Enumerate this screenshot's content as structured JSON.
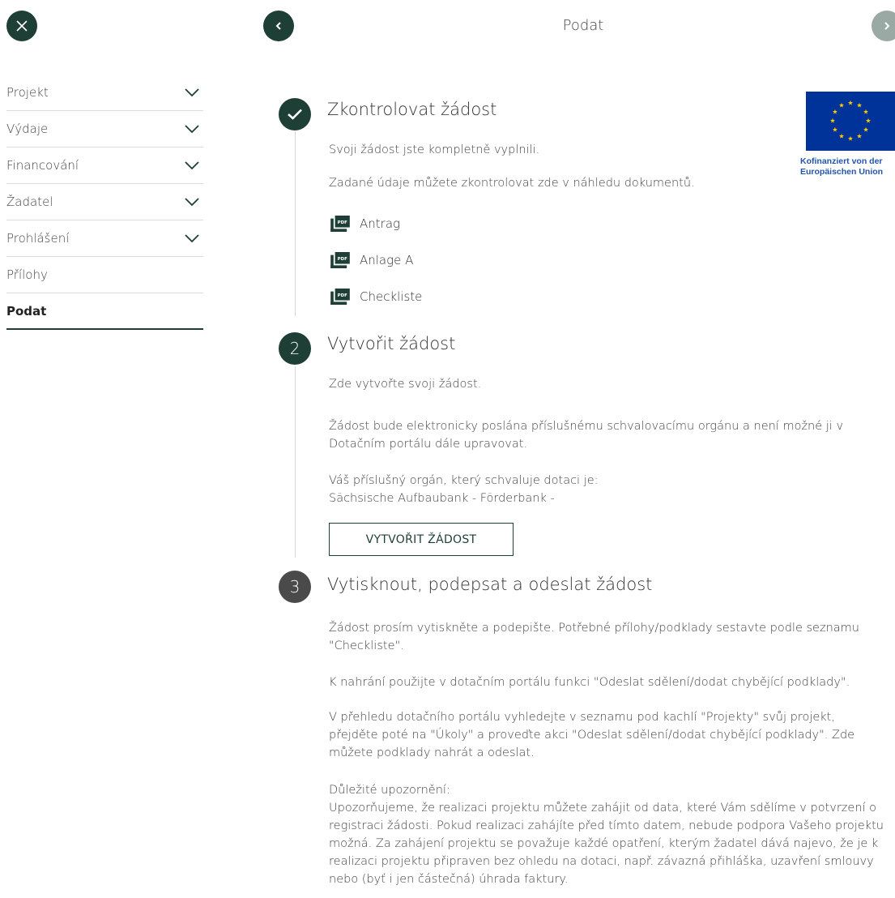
{
  "header": {
    "title": "Podat"
  },
  "sidebar": {
    "items": [
      {
        "label": "Projekt"
      },
      {
        "label": "Výdaje"
      },
      {
        "label": "Financování"
      },
      {
        "label": "Žadatel"
      },
      {
        "label": "Prohlášení"
      },
      {
        "label": "Přílohy"
      },
      {
        "label": "Podat"
      }
    ]
  },
  "step1": {
    "title": "Zkontrolovat žádost",
    "text1": "Svoji žádost jste kompletně vyplnili.",
    "text2": "Zadané údaje můžete zkontrolovat zde v náhledu dokumentů.",
    "documents": [
      {
        "label": "Antrag"
      },
      {
        "label": "Anlage A"
      },
      {
        "label": "Checkliste"
      }
    ]
  },
  "step2": {
    "number": "2",
    "title": "Vytvořit žádost",
    "text1": "Zde vytvořte svoji žádost.",
    "text2": "Žádost bude elektronicky poslána příslušnému schvalovacímu orgánu a není možné ji v Dotačním portálu dále upravovat.",
    "text3a": "Váš příslušný orgán, který schvaluje dotaci je:",
    "text3b": "Sächsische Aufbaubank - Förderbank -",
    "button_label": "VYTVOŘIT ŽÁDOST"
  },
  "step3": {
    "number": "3",
    "title": "Vytisknout, podepsat a odeslat žádost",
    "text1": "Žádost prosím vytiskněte a podepište. Potřebné přílohy/podklady sestavte podle seznamu \"Checkliste\".",
    "text2": "K nahrání použijte v dotačním portálu funkci \"Odeslat sdělení/dodat chybějící podklady\".",
    "text3": "V přehledu dotačního portálu vyhledejte v seznamu pod kachlí \"Projekty\" svůj projekt, přejděte poté na \"Úkoly\" a proveďte akci \"Odeslat sdělení/dodat chybějící podklady\". Zde můžete podklady nahrát a odeslat.",
    "notice_title": "Důležité upozornění:",
    "notice_text": "Upozorňujeme, že realizaci projektu můžete zahájit od data, které Vám sdělíme v potvrzení o registraci žádosti. Pokud realizaci zahájíte před tímto datem, nebude podpora Vašeho projektu možná. Za zahájení projektu se považuje každé opatření, kterým žadatel dává najevo, že je k realizaci projektu připraven bez ohledu na dotaci, např. závazná přihláška, uzavření smlouvy nebo (byť i jen částečná) úhrada faktury."
  },
  "eu_logo": {
    "line1": "Kofinanziert von der",
    "line2": "Europäischen Union"
  },
  "colors": {
    "primary": "#1e3f36",
    "disabled": "#9aa9a4",
    "eu_blue": "#003399",
    "eu_star": "#ffcc00"
  }
}
